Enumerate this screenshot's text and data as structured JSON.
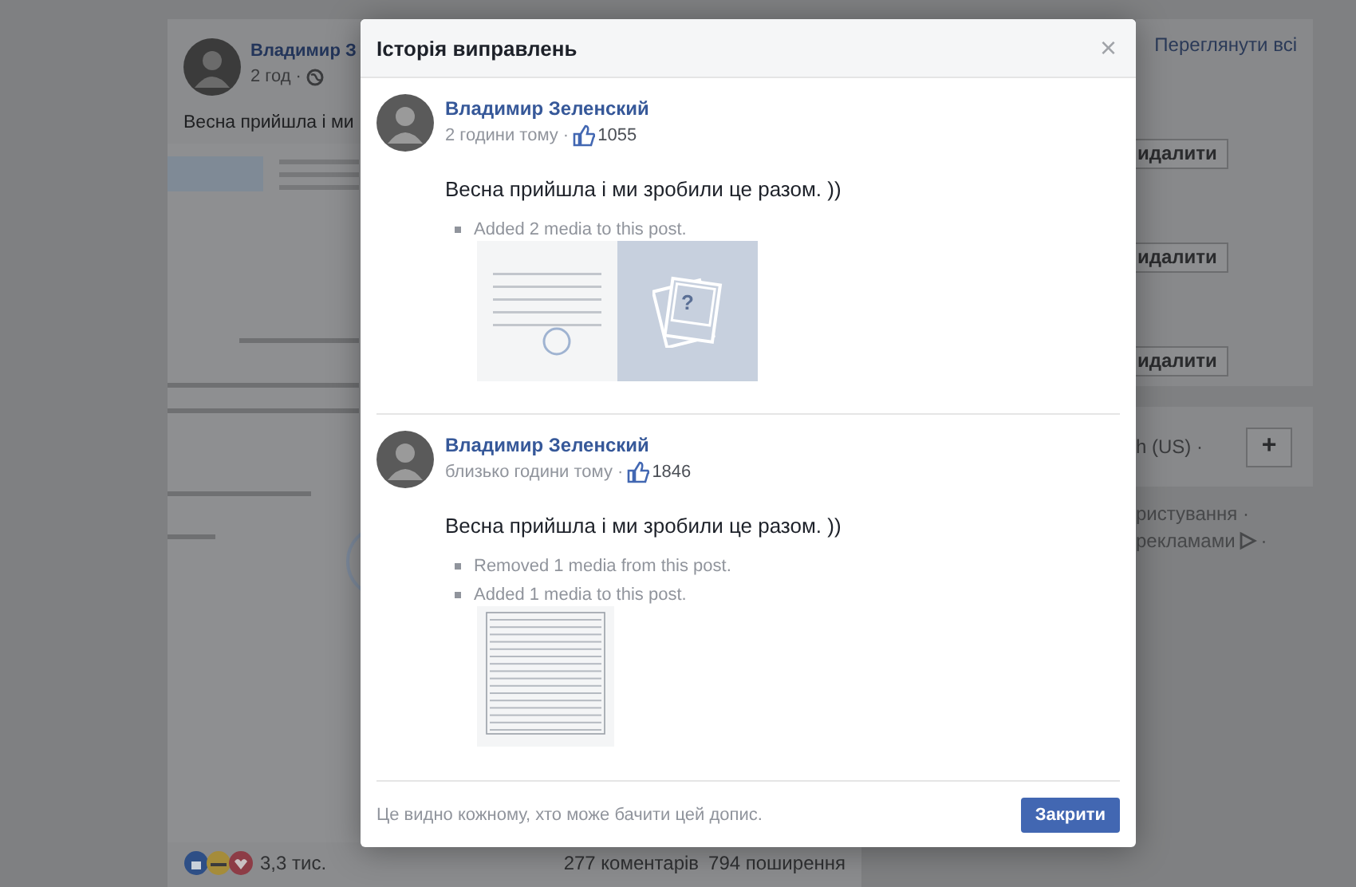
{
  "background_post": {
    "author": "Владимир З",
    "time": "2 год ·",
    "text": "Весна прийшла і ми",
    "reactions_count": "3,3 тис.",
    "comments": "277 коментарів",
    "shares": "794 поширення"
  },
  "sidebar": {
    "see_all": "Переглянути всі",
    "buttons": [
      "идалити",
      "идалити",
      "идалити"
    ],
    "language": "h (US) ·",
    "add_button": "+",
    "footer_lines": [
      "ристування ·",
      "рекламами"
    ],
    "footer_separator": "·"
  },
  "dialog": {
    "title": "Історія виправлень",
    "close": "×",
    "revisions": [
      {
        "author": "Владимир Зеленский",
        "time": "2 години тому ·",
        "likes": "1055",
        "text": "Весна прийшла і ми зробили це разом. ))",
        "changes": [
          {
            "text": "Added 2 media to this post.",
            "media": [
              {
                "kind": "document"
              },
              {
                "kind": "placeholder",
                "mark": "?"
              }
            ]
          }
        ]
      },
      {
        "author": "Владимир Зеленский",
        "time": "близько години тому ·",
        "likes": "1846",
        "text": "Весна прийшла і ми зробили це разом. ))",
        "changes": [
          {
            "text": "Removed 1 media from this post."
          },
          {
            "text": "Added 1 media to this post.",
            "media": [
              {
                "kind": "table"
              }
            ]
          }
        ]
      }
    ],
    "footer_note": "Це видно кожному, хто може бачити цей допис.",
    "close_button": "Закрити"
  }
}
